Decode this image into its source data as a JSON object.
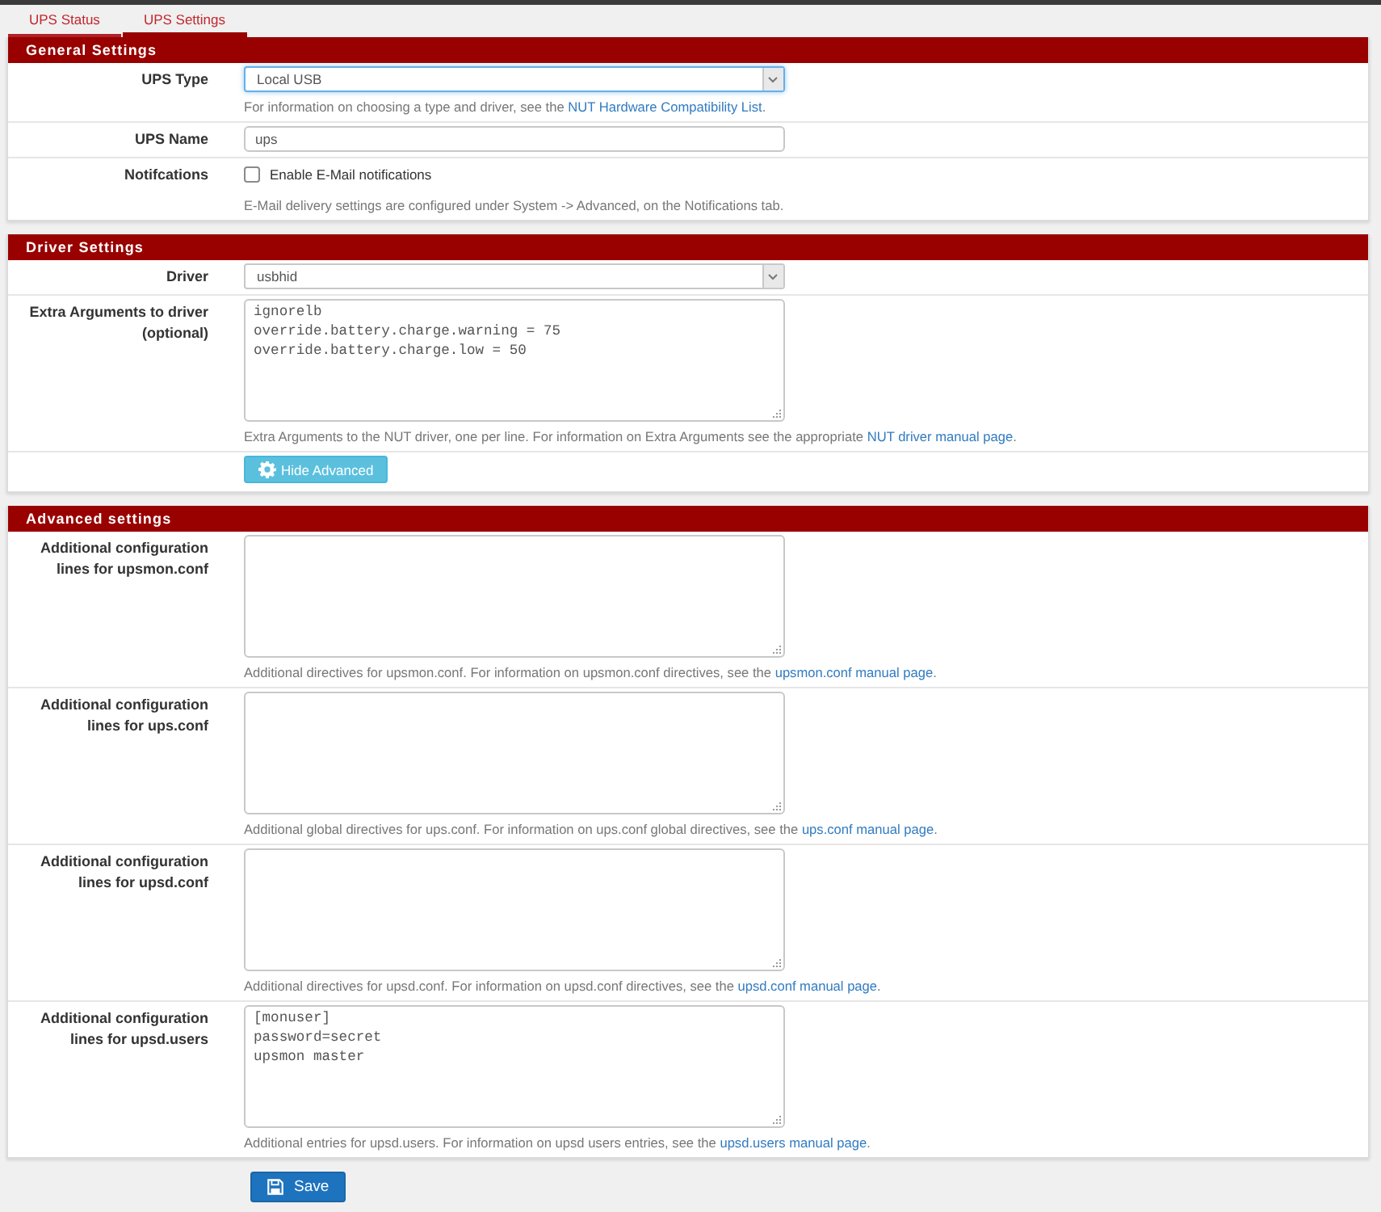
{
  "tabs": [
    {
      "label": "UPS Status",
      "selected": false
    },
    {
      "label": "UPS Settings",
      "selected": true
    }
  ],
  "sections": [
    {
      "title": "General Settings",
      "rows": [
        {
          "kind": "select",
          "label": "UPS Type",
          "value": "Local USB",
          "focused": true,
          "help": {
            "text": "For information on choosing a type and driver, see the ",
            "link": "NUT Hardware Compatibility List",
            "after": "."
          }
        },
        {
          "kind": "input",
          "label": "UPS Name",
          "value": "ups",
          "focused": false
        },
        {
          "kind": "checkbox",
          "label": "Notifcations",
          "option": "Enable E-Mail notifications",
          "checked": false,
          "help": {
            "text": "E-Mail delivery settings are configured under System -> Advanced, on the Notifications tab."
          }
        }
      ]
    },
    {
      "title": "Driver Settings",
      "rows": [
        {
          "kind": "select",
          "label": "Driver",
          "value": "usbhid",
          "focused": false
        },
        {
          "kind": "textarea",
          "label": "Extra Arguments to driver (optional)",
          "value": "ignorelb\noverride.battery.charge.warning = 75\noverride.battery.charge.low = 50",
          "focused": false,
          "help": {
            "text": "Extra Arguments to the NUT driver, one per line. For information on Extra Arguments see the appropriate ",
            "link": "NUT driver manual page",
            "after": "."
          }
        },
        {
          "kind": "button",
          "button": "Hide Advanced"
        }
      ]
    },
    {
      "title": "Advanced settings",
      "rows": [
        {
          "kind": "textarea",
          "label": "Additional configuration lines for upsmon.conf",
          "focused": false,
          "help": {
            "text": "Additional directives for upsmon.conf. For information on upsmon.conf directives, see the ",
            "link": "upsmon.conf manual page",
            "after": "."
          }
        },
        {
          "kind": "textarea",
          "label": "Additional configuration lines for ups.conf",
          "focused": false,
          "help": {
            "text": "Additional global directives for ups.conf. For information on ups.conf global directives, see the ",
            "link": "ups.conf manual page",
            "after": "."
          }
        },
        {
          "kind": "textarea",
          "label": "Additional configuration lines for upsd.conf",
          "focused": false,
          "help": {
            "text": "Additional directives for upsd.conf. For information on upsd.conf directives, see the ",
            "link": "upsd.conf manual page",
            "after": "."
          }
        },
        {
          "kind": "textarea",
          "label": "Additional configuration lines for upsd.users",
          "value": "[monuser]\npassword=secret\nupsmon master",
          "focused": false,
          "help": {
            "text": "Additional entries for upsd.users. For information on upsd users entries, see the ",
            "link": "upsd.users manual page",
            "after": "."
          }
        }
      ]
    }
  ],
  "save_button": "Save"
}
